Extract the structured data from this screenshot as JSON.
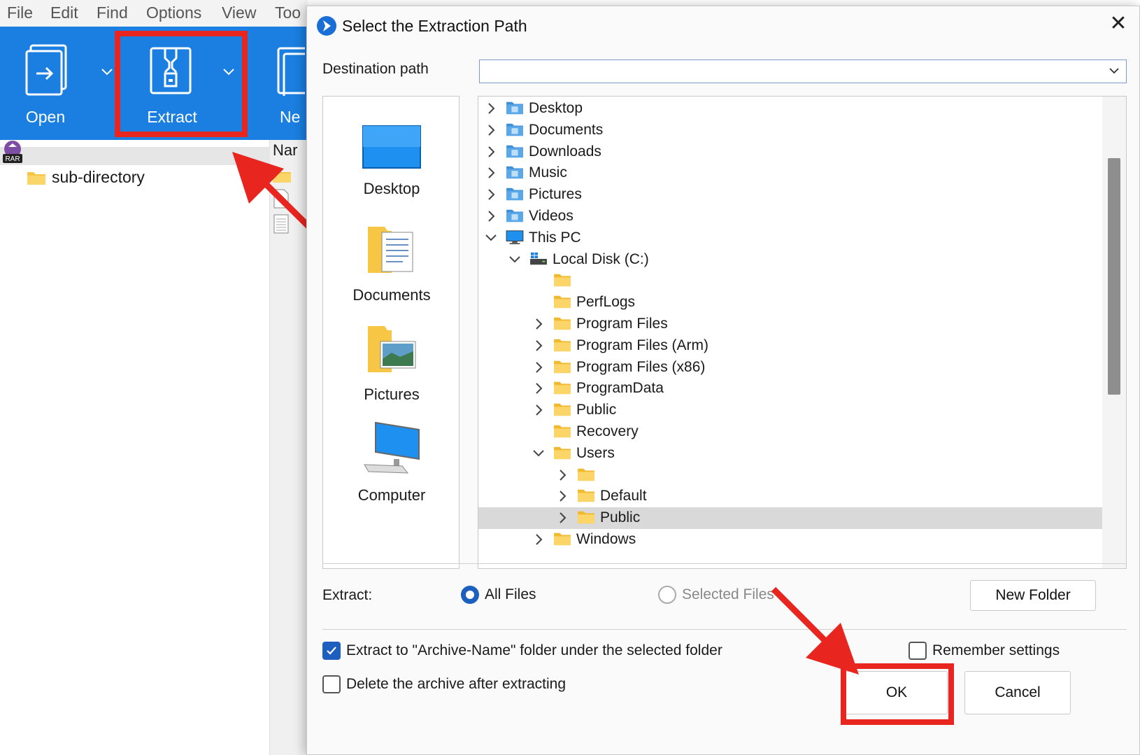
{
  "menubar": {
    "items": [
      "File",
      "Edit",
      "Find",
      "Options",
      "View",
      "Too"
    ]
  },
  "ribbon": {
    "open_label": "Open",
    "extract_label": "Extract",
    "new_label": "Ne"
  },
  "left_pane": {
    "archive_badge": "RAR",
    "subdir_label": "sub-directory"
  },
  "file_list": {
    "name_header": "Nar"
  },
  "dialog": {
    "title": "Select the Extraction Path",
    "close_glyph": "✕",
    "destination_label": "Destination path",
    "destination_value": "",
    "places": [
      {
        "label": "Desktop",
        "icon": "desktop-icon"
      },
      {
        "label": "Documents",
        "icon": "documents-folder-icon"
      },
      {
        "label": "Pictures",
        "icon": "pictures-folder-icon"
      },
      {
        "label": "Computer",
        "icon": "computer-icon"
      }
    ],
    "tree": [
      {
        "label": "Desktop",
        "level": 0,
        "chevron": "right",
        "icon": "desktop-folder-icon"
      },
      {
        "label": "Documents",
        "level": 0,
        "chevron": "right",
        "icon": "documents-folder-icon"
      },
      {
        "label": "Downloads",
        "level": 0,
        "chevron": "right",
        "icon": "downloads-folder-icon"
      },
      {
        "label": "Music",
        "level": 0,
        "chevron": "right",
        "icon": "music-folder-icon"
      },
      {
        "label": "Pictures",
        "level": 0,
        "chevron": "right",
        "icon": "pictures-folder-icon"
      },
      {
        "label": "Videos",
        "level": 0,
        "chevron": "right",
        "icon": "videos-folder-icon"
      },
      {
        "label": "This PC",
        "level": 0,
        "chevron": "down",
        "icon": "this-pc-icon"
      },
      {
        "label": "Local Disk (C:)",
        "level": 1,
        "chevron": "down",
        "icon": "local-disk-icon"
      },
      {
        "label": "",
        "level": 2,
        "chevron": "none",
        "icon": "folder-icon"
      },
      {
        "label": "PerfLogs",
        "level": 2,
        "chevron": "none",
        "icon": "folder-icon"
      },
      {
        "label": "Program Files",
        "level": 2,
        "chevron": "right",
        "icon": "folder-icon"
      },
      {
        "label": "Program Files (Arm)",
        "level": 2,
        "chevron": "right",
        "icon": "folder-icon"
      },
      {
        "label": "Program Files (x86)",
        "level": 2,
        "chevron": "right",
        "icon": "folder-icon"
      },
      {
        "label": "ProgramData",
        "level": 2,
        "chevron": "right",
        "icon": "folder-icon"
      },
      {
        "label": "Public",
        "level": 2,
        "chevron": "right",
        "icon": "folder-icon"
      },
      {
        "label": "Recovery",
        "level": 2,
        "chevron": "none",
        "icon": "folder-icon"
      },
      {
        "label": "Users",
        "level": 2,
        "chevron": "down",
        "icon": "folder-icon"
      },
      {
        "label": "",
        "level": 3,
        "chevron": "right",
        "icon": "folder-icon"
      },
      {
        "label": "Default",
        "level": 3,
        "chevron": "right",
        "icon": "folder-icon"
      },
      {
        "label": "Public",
        "level": 3,
        "chevron": "right",
        "icon": "folder-icon",
        "selected": true
      },
      {
        "label": "Windows",
        "level": 2,
        "chevron": "right",
        "icon": "folder-icon"
      }
    ],
    "extract_label": "Extract:",
    "radio_all_files": "All Files",
    "radio_selected_files": "Selected Files",
    "radio_all_files_checked": true,
    "new_folder_button": "New Folder",
    "checkbox_extract_to_folder": "Extract to \"Archive-Name\" folder under the selected folder",
    "checkbox_extract_to_folder_checked": true,
    "checkbox_delete_archive": "Delete the archive after extracting",
    "checkbox_delete_archive_checked": false,
    "checkbox_remember_settings": "Remember settings",
    "checkbox_remember_settings_checked": false,
    "ok_button": "OK",
    "cancel_button": "Cancel"
  },
  "colors": {
    "ribbon_blue": "#1a7fe0",
    "highlight_red": "#e8251f",
    "accent_blue": "#1d5fbf",
    "folder_yellow": "#f6c644",
    "tree_selection": "#d9d9d9"
  }
}
